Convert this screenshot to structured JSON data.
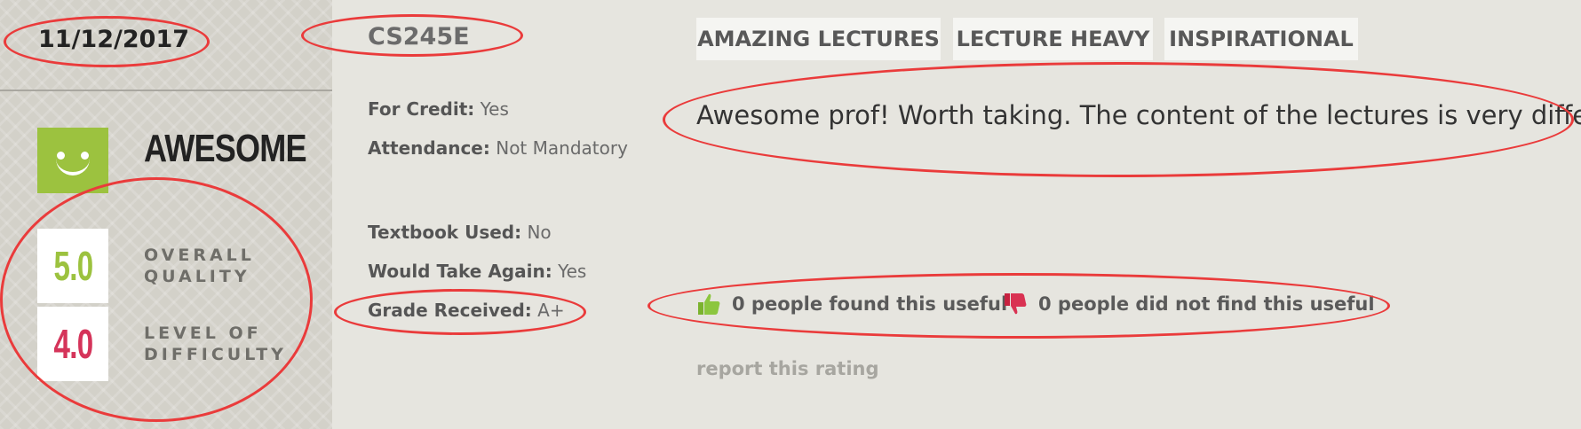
{
  "date": "11/12/2017",
  "rating": {
    "word": "AWESOME",
    "overall_quality": {
      "value": "5.0",
      "label_line1": "OVERALL",
      "label_line2": "QUALITY"
    },
    "difficulty": {
      "value": "4.0",
      "label_line1": "LEVEL OF",
      "label_line2": "DIFFICULTY"
    }
  },
  "course": "CS245E",
  "details": {
    "for_credit": {
      "label": "For Credit:",
      "value": "Yes"
    },
    "attendance": {
      "label": "Attendance:",
      "value": "Not Mandatory"
    },
    "textbook": {
      "label": "Textbook Used:",
      "value": "No"
    },
    "take_again": {
      "label": "Would Take Again:",
      "value": "Yes"
    },
    "grade": {
      "label": "Grade Received:",
      "value": "A+"
    }
  },
  "tags": [
    "AMAZING LECTURES",
    "LECTURE HEAVY",
    "INSPIRATIONAL"
  ],
  "comment": "Awesome prof! Worth taking. The content of the lectures is very diffecult",
  "votes": {
    "useful": "0 people found this useful",
    "not_useful": "0 people did not find this useful"
  },
  "report_link": "report this rating",
  "colors": {
    "quality": "#9cc23f",
    "difficulty": "#d5345a",
    "annotation": "#ea3b3b"
  }
}
